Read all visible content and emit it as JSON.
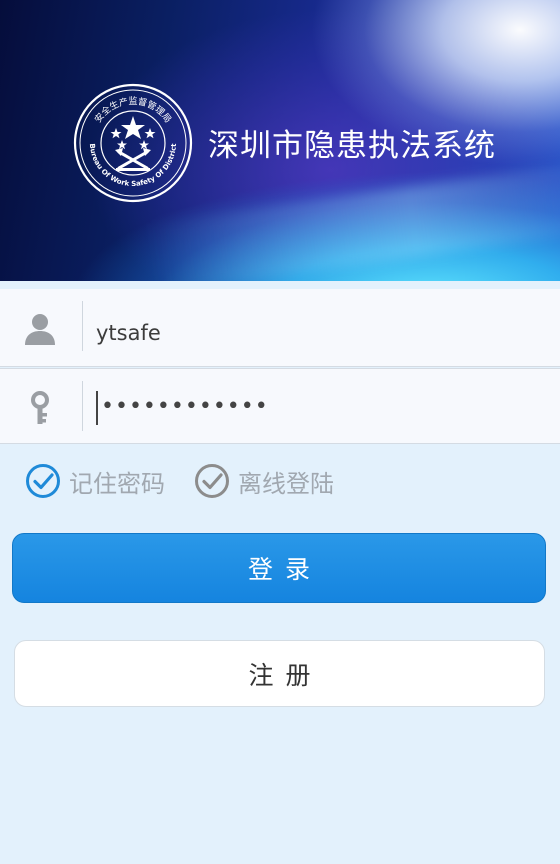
{
  "header": {
    "title": "深圳市隐患执法系统",
    "emblem": {
      "icon": "safety-bureau-emblem",
      "text_top": "安全生产监督管理局",
      "text_bottom": "Bureau Of Work Safety Of District"
    }
  },
  "login_form": {
    "username": {
      "icon": "user-icon",
      "value": "ytsafe"
    },
    "password": {
      "icon": "key-icon",
      "masked_value": "••••••••••••"
    }
  },
  "options": {
    "remember_password": {
      "label": "记住密码",
      "checked": true,
      "color": "#1f8ad8"
    },
    "offline_login": {
      "label": "离线登陆",
      "checked": true,
      "color": "#8c8c8c"
    }
  },
  "buttons": {
    "login_label": "登录",
    "register_label": "注册"
  },
  "colors": {
    "accent": "#1a8ae2",
    "background": "#e3f1fc"
  }
}
